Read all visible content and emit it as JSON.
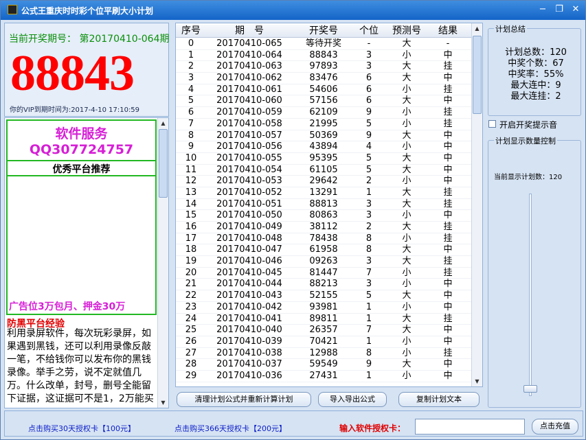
{
  "window": {
    "title": "公式王重庆时时彩个位平刷大小计划",
    "minimize_label": "−",
    "restore_label": "❐",
    "close_label": "✕"
  },
  "draw": {
    "label": "当前开奖期号： 第20170410-064期",
    "number": "88843",
    "vip_expiry": "你的VIP到期时间为:2017-4-10 17:10:59"
  },
  "ad": {
    "title": "软件服务",
    "qq": "QQ307724757",
    "recommend": "优秀平台推荐",
    "price": "广告位3万包月、押金30万",
    "fraud_title": "防黑平台经验",
    "fraud_body": "利用录屏软件，每次玩彩录屏，如果遇到黑钱，还可以利用录像反敲一笔，不给钱你可以发布你的黑钱录像。举手之劳，说不定就值几万。什么改单，封号，删号全能留下证据，这证据可不是1，2万能买"
  },
  "table": {
    "headers": [
      "序号",
      "期　号",
      "开奖号",
      "个位",
      "预测号",
      "结果"
    ],
    "rows": [
      [
        "0",
        "20170410-065",
        "等待开奖",
        "-",
        "大",
        "-"
      ],
      [
        "1",
        "20170410-064",
        "88843",
        "3",
        "小",
        "中"
      ],
      [
        "2",
        "20170410-063",
        "97893",
        "3",
        "大",
        "挂"
      ],
      [
        "3",
        "20170410-062",
        "83476",
        "6",
        "大",
        "中"
      ],
      [
        "4",
        "20170410-061",
        "54606",
        "6",
        "小",
        "挂"
      ],
      [
        "5",
        "20170410-060",
        "57156",
        "6",
        "大",
        "中"
      ],
      [
        "6",
        "20170410-059",
        "62109",
        "9",
        "小",
        "挂"
      ],
      [
        "7",
        "20170410-058",
        "21995",
        "5",
        "小",
        "挂"
      ],
      [
        "8",
        "20170410-057",
        "50369",
        "9",
        "大",
        "中"
      ],
      [
        "9",
        "20170410-056",
        "43894",
        "4",
        "小",
        "中"
      ],
      [
        "10",
        "20170410-055",
        "95395",
        "5",
        "大",
        "中"
      ],
      [
        "11",
        "20170410-054",
        "61105",
        "5",
        "大",
        "中"
      ],
      [
        "12",
        "20170410-053",
        "29642",
        "2",
        "小",
        "中"
      ],
      [
        "13",
        "20170410-052",
        "13291",
        "1",
        "大",
        "挂"
      ],
      [
        "14",
        "20170410-051",
        "88813",
        "3",
        "大",
        "挂"
      ],
      [
        "15",
        "20170410-050",
        "80863",
        "3",
        "小",
        "中"
      ],
      [
        "16",
        "20170410-049",
        "38112",
        "2",
        "大",
        "挂"
      ],
      [
        "17",
        "20170410-048",
        "78438",
        "8",
        "小",
        "挂"
      ],
      [
        "18",
        "20170410-047",
        "61958",
        "8",
        "大",
        "中"
      ],
      [
        "19",
        "20170410-046",
        "09263",
        "3",
        "大",
        "挂"
      ],
      [
        "20",
        "20170410-045",
        "81447",
        "7",
        "小",
        "挂"
      ],
      [
        "21",
        "20170410-044",
        "88213",
        "3",
        "小",
        "中"
      ],
      [
        "22",
        "20170410-043",
        "52155",
        "5",
        "大",
        "中"
      ],
      [
        "23",
        "20170410-042",
        "93981",
        "1",
        "小",
        "中"
      ],
      [
        "24",
        "20170410-041",
        "89811",
        "1",
        "大",
        "挂"
      ],
      [
        "25",
        "20170410-040",
        "26357",
        "7",
        "大",
        "中"
      ],
      [
        "26",
        "20170410-039",
        "70421",
        "1",
        "小",
        "中"
      ],
      [
        "27",
        "20170410-038",
        "12988",
        "8",
        "小",
        "挂"
      ],
      [
        "28",
        "20170410-037",
        "59549",
        "9",
        "大",
        "中"
      ],
      [
        "29",
        "20170410-036",
        "27431",
        "1",
        "小",
        "中"
      ]
    ]
  },
  "buttons": {
    "clear": "清理计划公式并重新计算计划",
    "import_export": "导入导出公式",
    "copy": "复制计划文本"
  },
  "summary": {
    "title": "计划总结",
    "lines": [
      "计划总数：120",
      "中奖个数：67",
      "中奖率：55%",
      "最大连中：9",
      "最大连挂：2"
    ]
  },
  "options": {
    "notify_label": "开启开奖提示音",
    "notify_checked": false
  },
  "control": {
    "title": "计划显示数量控制",
    "count_label": "当前显示计划数：120"
  },
  "footer": {
    "buy30": "点击购买30天授权卡【100元】",
    "buy366": "点击购买366天授权卡【200元】",
    "auth_label": "输入软件授权卡：",
    "auth_value": "",
    "recharge": "点击充值"
  }
}
